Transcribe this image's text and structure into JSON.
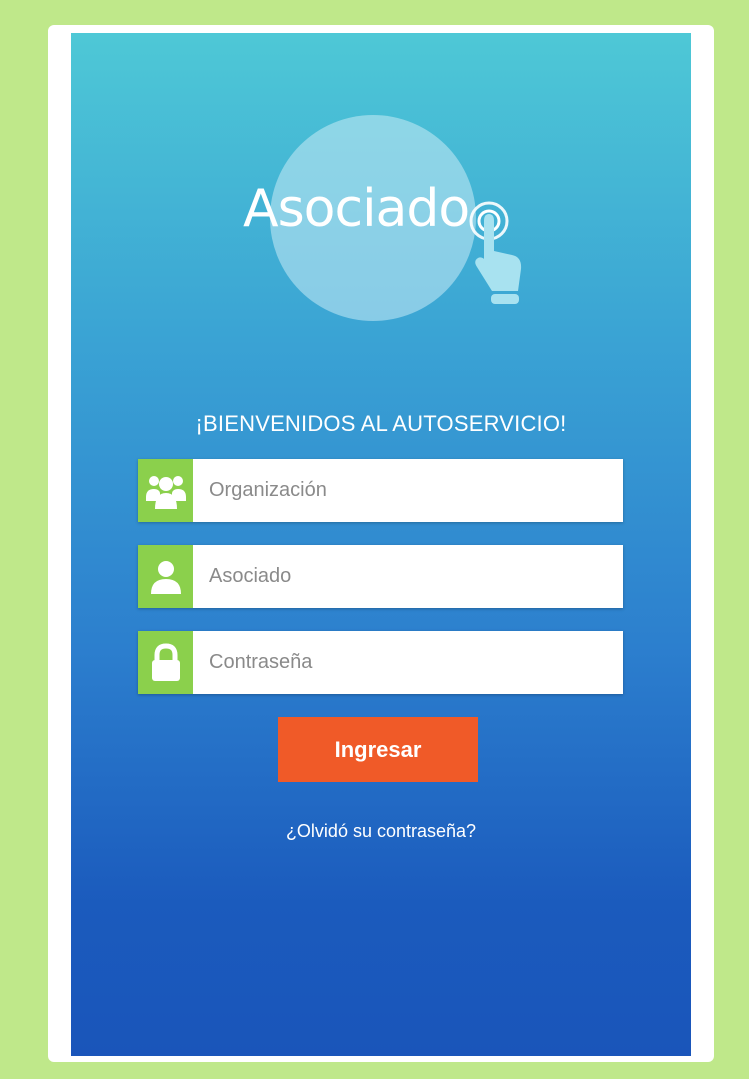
{
  "logo": {
    "text": "Asociado"
  },
  "welcome": "¡BIENVENIDOS AL AUTOSERVICIO!",
  "form": {
    "organization": {
      "placeholder": "Organización",
      "value": "",
      "icon": "group-icon"
    },
    "associate": {
      "placeholder": "Asociado",
      "value": "",
      "icon": "user-icon"
    },
    "password": {
      "placeholder": "Contraseña",
      "value": "",
      "icon": "lock-icon"
    },
    "submit_label": "Ingresar",
    "forgot_label": "¿Olvidó su contraseña?"
  },
  "colors": {
    "background": "#bfe88a",
    "gradient_top": "#4ec8d6",
    "gradient_bottom": "#1a55ba",
    "icon_box": "#8bd04c",
    "button": "#f05a28"
  }
}
